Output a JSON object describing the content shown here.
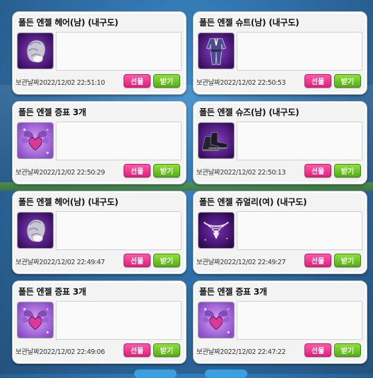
{
  "items": [
    {
      "title": "폴든 엔젤 헤어(남) (내구도)",
      "icon": "hair-icon",
      "date_label": "보관날짜",
      "date": "2022/12/02 22:51:10",
      "gift_label": "선물",
      "receive_label": "받기"
    },
    {
      "title": "폴든 엔젤 슈트(남) (내구도)",
      "icon": "suit-icon",
      "date_label": "보관날짜",
      "date": "2022/12/02 22:50:53",
      "gift_label": "선물",
      "receive_label": "받기"
    },
    {
      "title": "폴든 엔젤 증표 3개",
      "icon": "token-icon",
      "date_label": "보관날짜",
      "date": "2022/12/02 22:50:29",
      "gift_label": "선물",
      "receive_label": "받기"
    },
    {
      "title": "폴든 엔젤 슈즈(남) (내구도)",
      "icon": "shoes-icon",
      "date_label": "보관날짜",
      "date": "2022/12/02 22:50:13",
      "gift_label": "선물",
      "receive_label": "받기"
    },
    {
      "title": "폴든 엔젤 헤어(남) (내구도)",
      "icon": "hair-icon",
      "date_label": "보관날짜",
      "date": "2022/12/02 22:49:47",
      "gift_label": "선물",
      "receive_label": "받기"
    },
    {
      "title": "폴든 엔젤 쥬얼리(여) (내구도)",
      "icon": "jewelry-icon",
      "date_label": "보관날짜",
      "date": "2022/12/02 22:49:27",
      "gift_label": "선물",
      "receive_label": "받기"
    },
    {
      "title": "폴든 엔젤 증표 3개",
      "icon": "token-icon",
      "date_label": "보관날짜",
      "date": "2022/12/02 22:49:06",
      "gift_label": "선물",
      "receive_label": "받기"
    },
    {
      "title": "폴든 엔젤 증표 3개",
      "icon": "token-icon",
      "date_label": "보관날짜",
      "date": "2022/12/02 22:47:22",
      "gift_label": "선물",
      "receive_label": "받기"
    }
  ],
  "colors": {
    "gift": "#e0207c",
    "receive": "#55ad16",
    "icon_purple": "#5a1d8a"
  }
}
